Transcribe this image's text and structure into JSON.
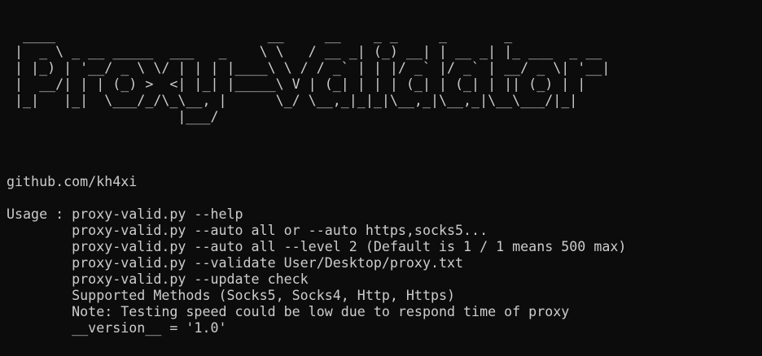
{
  "terminal": {
    "banner": [
      "  ____                          __     __    _ _     _       _",
      " |  _ \\ _ __ _____  ___   _    \\ \\   / __ _| (_) __| | __ _| |_ ___  _ __",
      " | |_) | '__/ _ \\ \\/ | | | |____\\ \\ / / _` | | |/ _` |/ _` | __/ _ \\| '__|",
      " |  __/| | | (_) >  <| |_| |_____\\ V | (_| | | | (_| | (_| | || (_) | |",
      " |_|   |_|  \\___/_/\\_\\__, |      \\_/ \\__,_|_|_|\\__,_|\\__,_|\\__\\___/|_|",
      "                     |___/"
    ],
    "author": "github.com/kh4xi",
    "usage": [
      "Usage : proxy-valid.py --help",
      "        proxy-valid.py --auto all or --auto https,socks5...",
      "        proxy-valid.py --auto all --level 2 (Default is 1 / 1 means 500 max)",
      "        proxy-valid.py --validate User/Desktop/proxy.txt",
      "        proxy-valid.py --update check",
      "        Supported Methods (Socks5, Socks4, Http, Https)",
      "        Note: Testing speed could be low due to respond time of proxy",
      "        __version__ = '1.0'"
    ]
  },
  "colors": {
    "background": "#0c0c0c",
    "text": "#cccccc"
  }
}
